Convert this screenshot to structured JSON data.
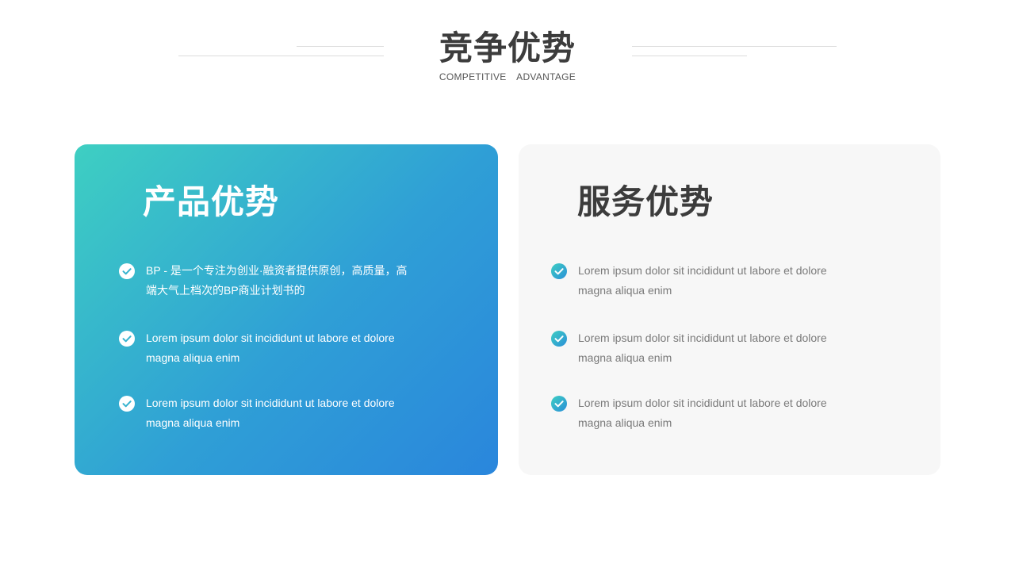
{
  "header": {
    "title": "竞争优势",
    "subtitle": "COMPETITIVE  ADVANTAGE"
  },
  "cards": [
    {
      "title": "产品优势",
      "items": [
        {
          "text": "BP - 是一个专注为创业·融资者提供原创，高质量，高端大气上档次的BP商业计划书的"
        },
        {
          "text": "Lorem ipsum dolor sit incididunt ut labore et dolore magna aliqua enim"
        },
        {
          "text": "Lorem ipsum dolor sit incididunt ut labore et dolore magna aliqua enim"
        }
      ]
    },
    {
      "title": "服务优势",
      "items": [
        {
          "text": "Lorem ipsum dolor sit incididunt ut labore et dolore magna aliqua enim"
        },
        {
          "text": "Lorem ipsum dolor sit incididunt ut labore et dolore magna aliqua enim"
        },
        {
          "text": "Lorem ipsum dolor sit incididunt ut labore et dolore magna aliqua enim"
        }
      ]
    }
  ],
  "icons": {
    "check": "check-circle-icon"
  },
  "colors": {
    "gradient_start": "#3ecfc2",
    "gradient_end": "#2a86dc",
    "title_text": "#3c3c3c",
    "card_light_bg": "#f7f7f7"
  }
}
